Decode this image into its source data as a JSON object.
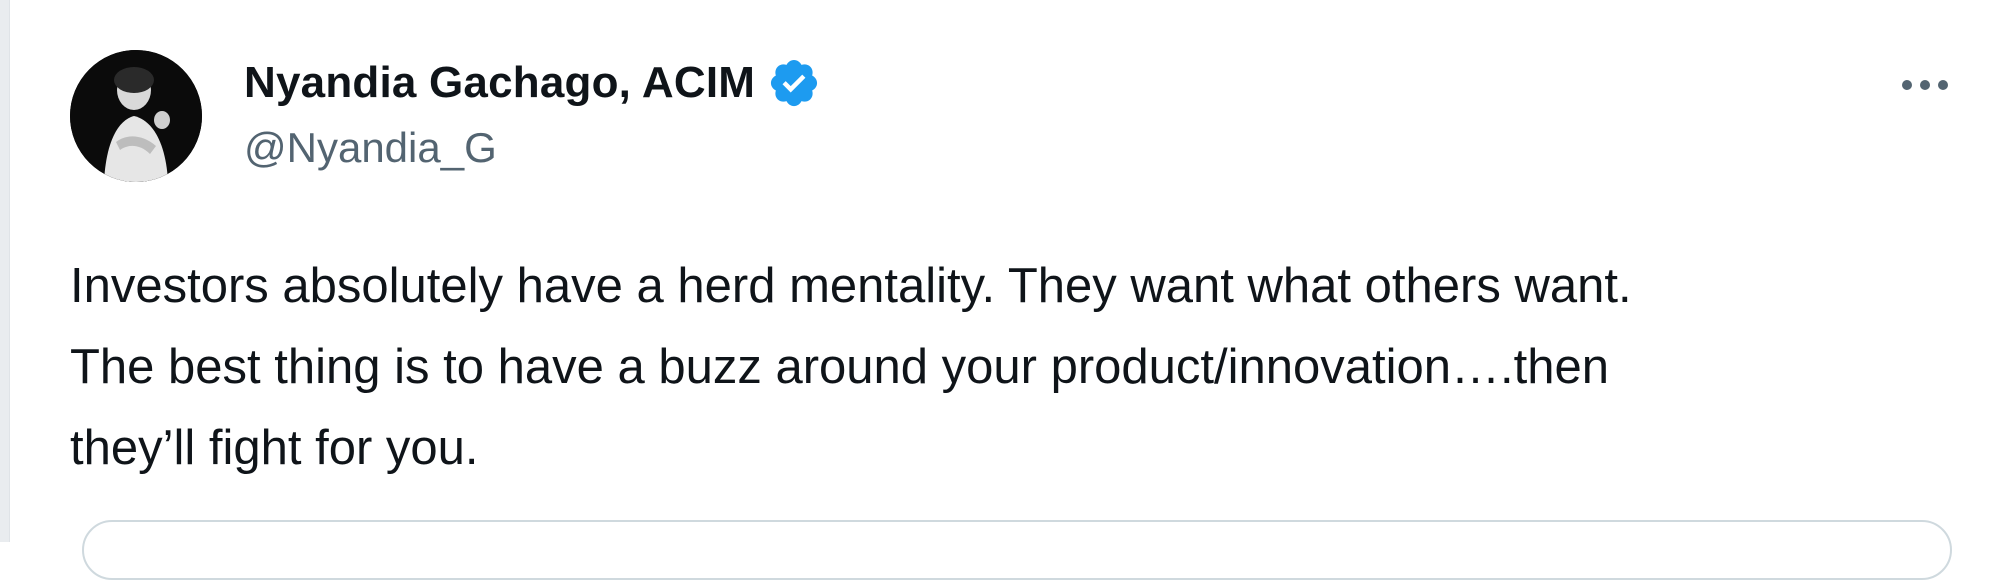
{
  "tweet": {
    "author": {
      "display_name": "Nyandia Gachago, ACIM",
      "handle": "@Nyandia_G",
      "verified": true,
      "verified_color": "#1d9bf0",
      "avatar_icon": "avatar-photo"
    },
    "text_lines": [
      "Investors absolutely have a herd mentality. They want what others want.",
      "The best thing is to have a buzz around your product/innovation….then",
      "they’ll fight for you."
    ],
    "more_icon": "more-horizontal-icon"
  },
  "colors": {
    "primary_text": "#0f1419",
    "secondary_text": "#536471",
    "border": "#cfd9de"
  }
}
